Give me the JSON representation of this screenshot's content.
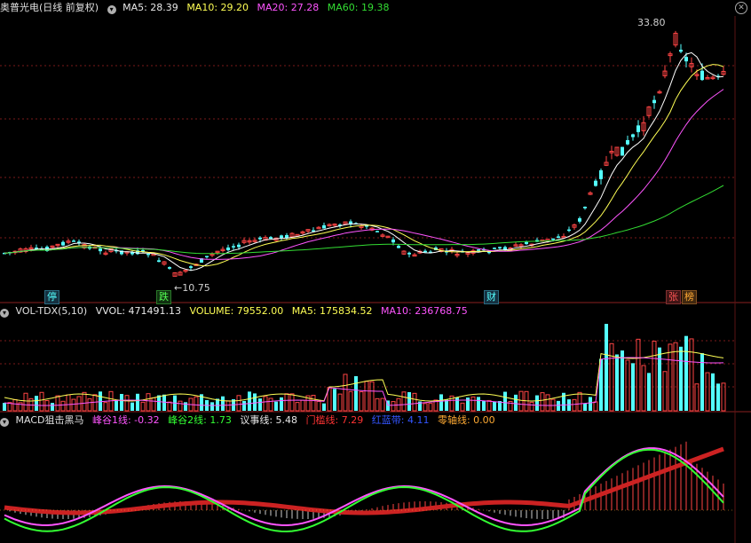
{
  "price_header": {
    "title": "奥普光电(日线 前复权)",
    "ma5": "MA5: 28.39",
    "ma10": "MA10: 29.20",
    "ma20": "MA20: 27.28",
    "ma60": "MA60: 19.38"
  },
  "vol_header": {
    "title": "VOL-TDX(5,10)",
    "vvol": "VVOL: 471491.13",
    "volume": "VOLUME: 79552.00",
    "ma5": "MA5: 175834.52",
    "ma10": "MA10: 236768.75"
  },
  "macd_header": {
    "title": "MACD狙击黑马",
    "f1": "峰谷1线: -0.32",
    "f2": "峰谷2线: 1.73",
    "yishi": "议事线: 5.48",
    "menjian": "门槛线: 7.29",
    "hongbo": "红蓝带: 4.11",
    "zero": "零轴线: 0.00"
  },
  "annotations": {
    "high": "33.80",
    "low": "10.75"
  },
  "event_tags": {
    "ting": "停",
    "die": "跌",
    "cai": "财",
    "zhang": "张",
    "bang": "榜"
  },
  "colors": {
    "up": "#ff4545",
    "down": "#54ffff",
    "ma5": "#ffffff",
    "ma10": "#ffff55",
    "ma20": "#ff55ff",
    "ma60": "#33dd33",
    "grid": "#7a1a1a"
  },
  "icons": {
    "header_toggle": "chevron-down-icon",
    "close": "close-icon"
  }
}
